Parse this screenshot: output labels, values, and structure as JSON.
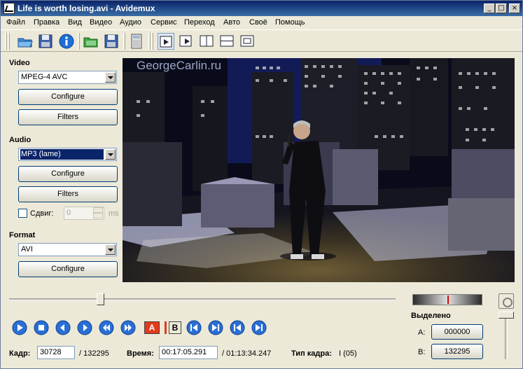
{
  "window": {
    "title": "Life is worth losing.avi - Avidemux"
  },
  "menu": [
    "Файл",
    "Правка",
    "Вид",
    "Видео",
    "Аудио",
    "Сервис",
    "Переход",
    "Авто",
    "Своё",
    "Помощь"
  ],
  "left": {
    "video_label": "Video",
    "video_codec": "MPEG-4 AVC",
    "video_configure": "Configure",
    "video_filters": "Filters",
    "audio_label": "Audio",
    "audio_codec": "MP3 (lame)",
    "audio_configure": "Configure",
    "audio_filters": "Filters",
    "shift_label": "Сдвиг:",
    "shift_value": "0",
    "shift_unit": "ms",
    "format_label": "Format",
    "format_value": "AVI",
    "format_configure": "Configure"
  },
  "video": {
    "watermark": "GeorgeCarlin.ru"
  },
  "transport": {
    "marker_a": "A",
    "marker_b": "B"
  },
  "info": {
    "frame_label": "Кадр:",
    "frame_value": "30728",
    "frame_total": "/ 132295",
    "time_label": "Время:",
    "time_value": "00:17:05.291",
    "time_total": "/ 01:13:34.247",
    "frame_type_label": "Тип кадра:",
    "frame_type_value": "I (05)"
  },
  "selection": {
    "title": "Выделено",
    "a_label": "A:",
    "a_value": "000000",
    "b_label": "B:",
    "b_value": "132295"
  },
  "timeline": {
    "position_fraction": 0.237
  },
  "colors": {
    "title_bar": "#0a246a",
    "selection": "#0a246a",
    "marker_a": "#e23a1c",
    "transport_blue": "#2a6fd6"
  }
}
